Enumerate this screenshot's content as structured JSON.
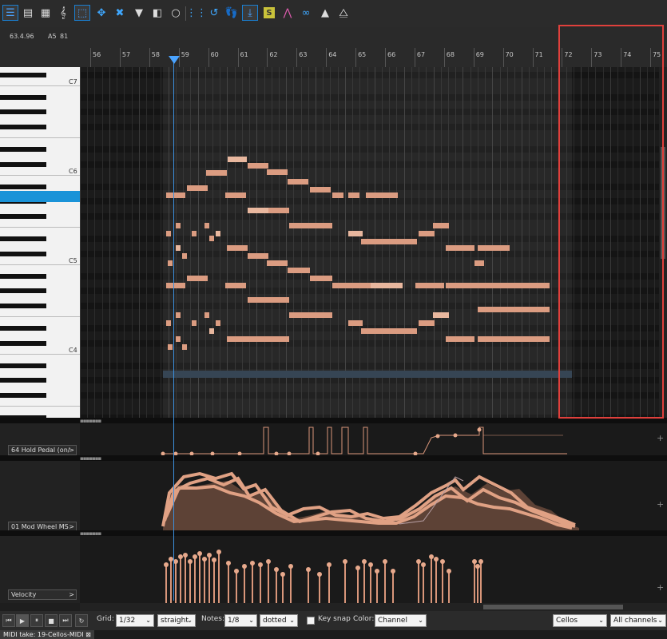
{
  "toolbar": {
    "icons": [
      "piano-roll-view-icon",
      "list-view-icon",
      "grid-view-icon",
      "treble-clef-icon",
      "select-notes-icon",
      "move-icon",
      "erase-icon",
      "filter-icon",
      "snap-window-icon",
      "zoom-icon",
      "grid-dots-icon",
      "undo-loop-icon",
      "foot-icon",
      "import-icon",
      "solo-s-icon",
      "peak-icon",
      "curve-icon",
      "triangle-icon",
      "double-triangle-icon"
    ],
    "solo_label": "S"
  },
  "info": {
    "position": "63.4.96",
    "note": "A5",
    "velocity": "81"
  },
  "ruler": {
    "bars": [
      "56",
      "57",
      "58",
      "59",
      "60",
      "61",
      "62",
      "63",
      "64",
      "65",
      "66",
      "67",
      "68",
      "69",
      "70",
      "71",
      "72",
      "73",
      "74",
      "75"
    ]
  },
  "keys": {
    "labels": [
      "C7",
      "C6",
      "C5",
      "C4"
    ]
  },
  "lanes": [
    {
      "label": "64 Hold Pedal (on/",
      "arrow": ">"
    },
    {
      "label": "01 Mod Wheel MS",
      "arrow": ">"
    },
    {
      "label": "Velocity",
      "arrow": ">"
    }
  ],
  "bottombar": {
    "grid_label": "Grid:",
    "grid_value": "1/32",
    "grid_type": "straight",
    "notes_label": "Notes:",
    "notes_value": "1/8",
    "notes_type": "dotted",
    "keysnap_label": "Key snap",
    "color_label": "Color:",
    "color_value": "Channel",
    "track": "Cellos",
    "channels": "All channels"
  },
  "status": {
    "take": "MIDI take: 19-Cellos-MIDI"
  },
  "colors": {
    "note": "#d9967a",
    "accent": "#3c8fdc",
    "highlight": "#e0403c"
  }
}
